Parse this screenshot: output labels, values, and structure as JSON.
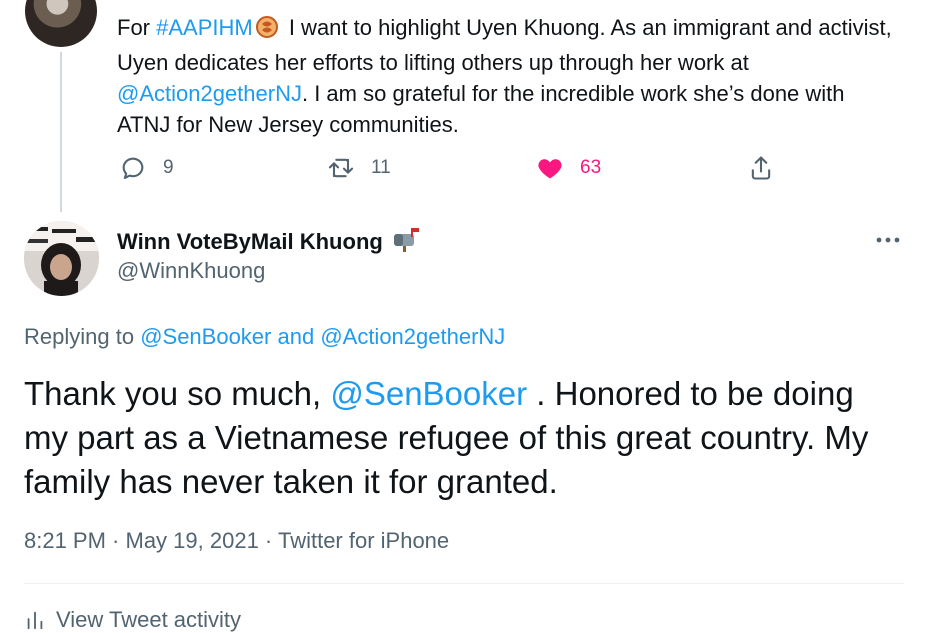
{
  "top_tweet": {
    "text_prefix": "For ",
    "hashtag": "#AAPIHM",
    "text_mid": " I want to highlight Uyen Khuong. As an immigrant and activist, Uyen dedicates her efforts to lifting others up through her work at ",
    "mention": "@Action2getherNJ",
    "text_suffix": ". I am so grateful for the incredible work she’s done with ATNJ for New Jersey communities.",
    "replies_count": "9",
    "retweets_count": "11",
    "likes_count": "63",
    "liked": true,
    "accent_like_color": "#f91880"
  },
  "main_tweet": {
    "display_name": "Winn VoteByMail Khuong",
    "handle": "@WinnKhuong",
    "replying_prefix": "Replying to ",
    "replying_user1": "@SenBooker",
    "replying_and": " and ",
    "replying_user2": "@Action2getherNJ",
    "text_prefix": "Thank you so much, ",
    "text_mention": "@SenBooker",
    "text_suffix": " .  Honored to be doing my part as a Vietnamese refugee of this great country. My family has never taken it for granted.",
    "time": "8:21 PM",
    "date": "May 19, 2021",
    "source": "Twitter for iPhone",
    "separator": " · ",
    "activity_label": "View Tweet activity"
  },
  "colors": {
    "link": "#1d9bf0",
    "muted": "#536471",
    "text": "#0f1419"
  },
  "icons": {
    "reply": "reply-icon",
    "retweet": "retweet-icon",
    "like": "heart-icon",
    "share": "share-icon",
    "more": "more-icon",
    "badge": "mailbox-icon",
    "hashflag": "hashflag-icon"
  }
}
